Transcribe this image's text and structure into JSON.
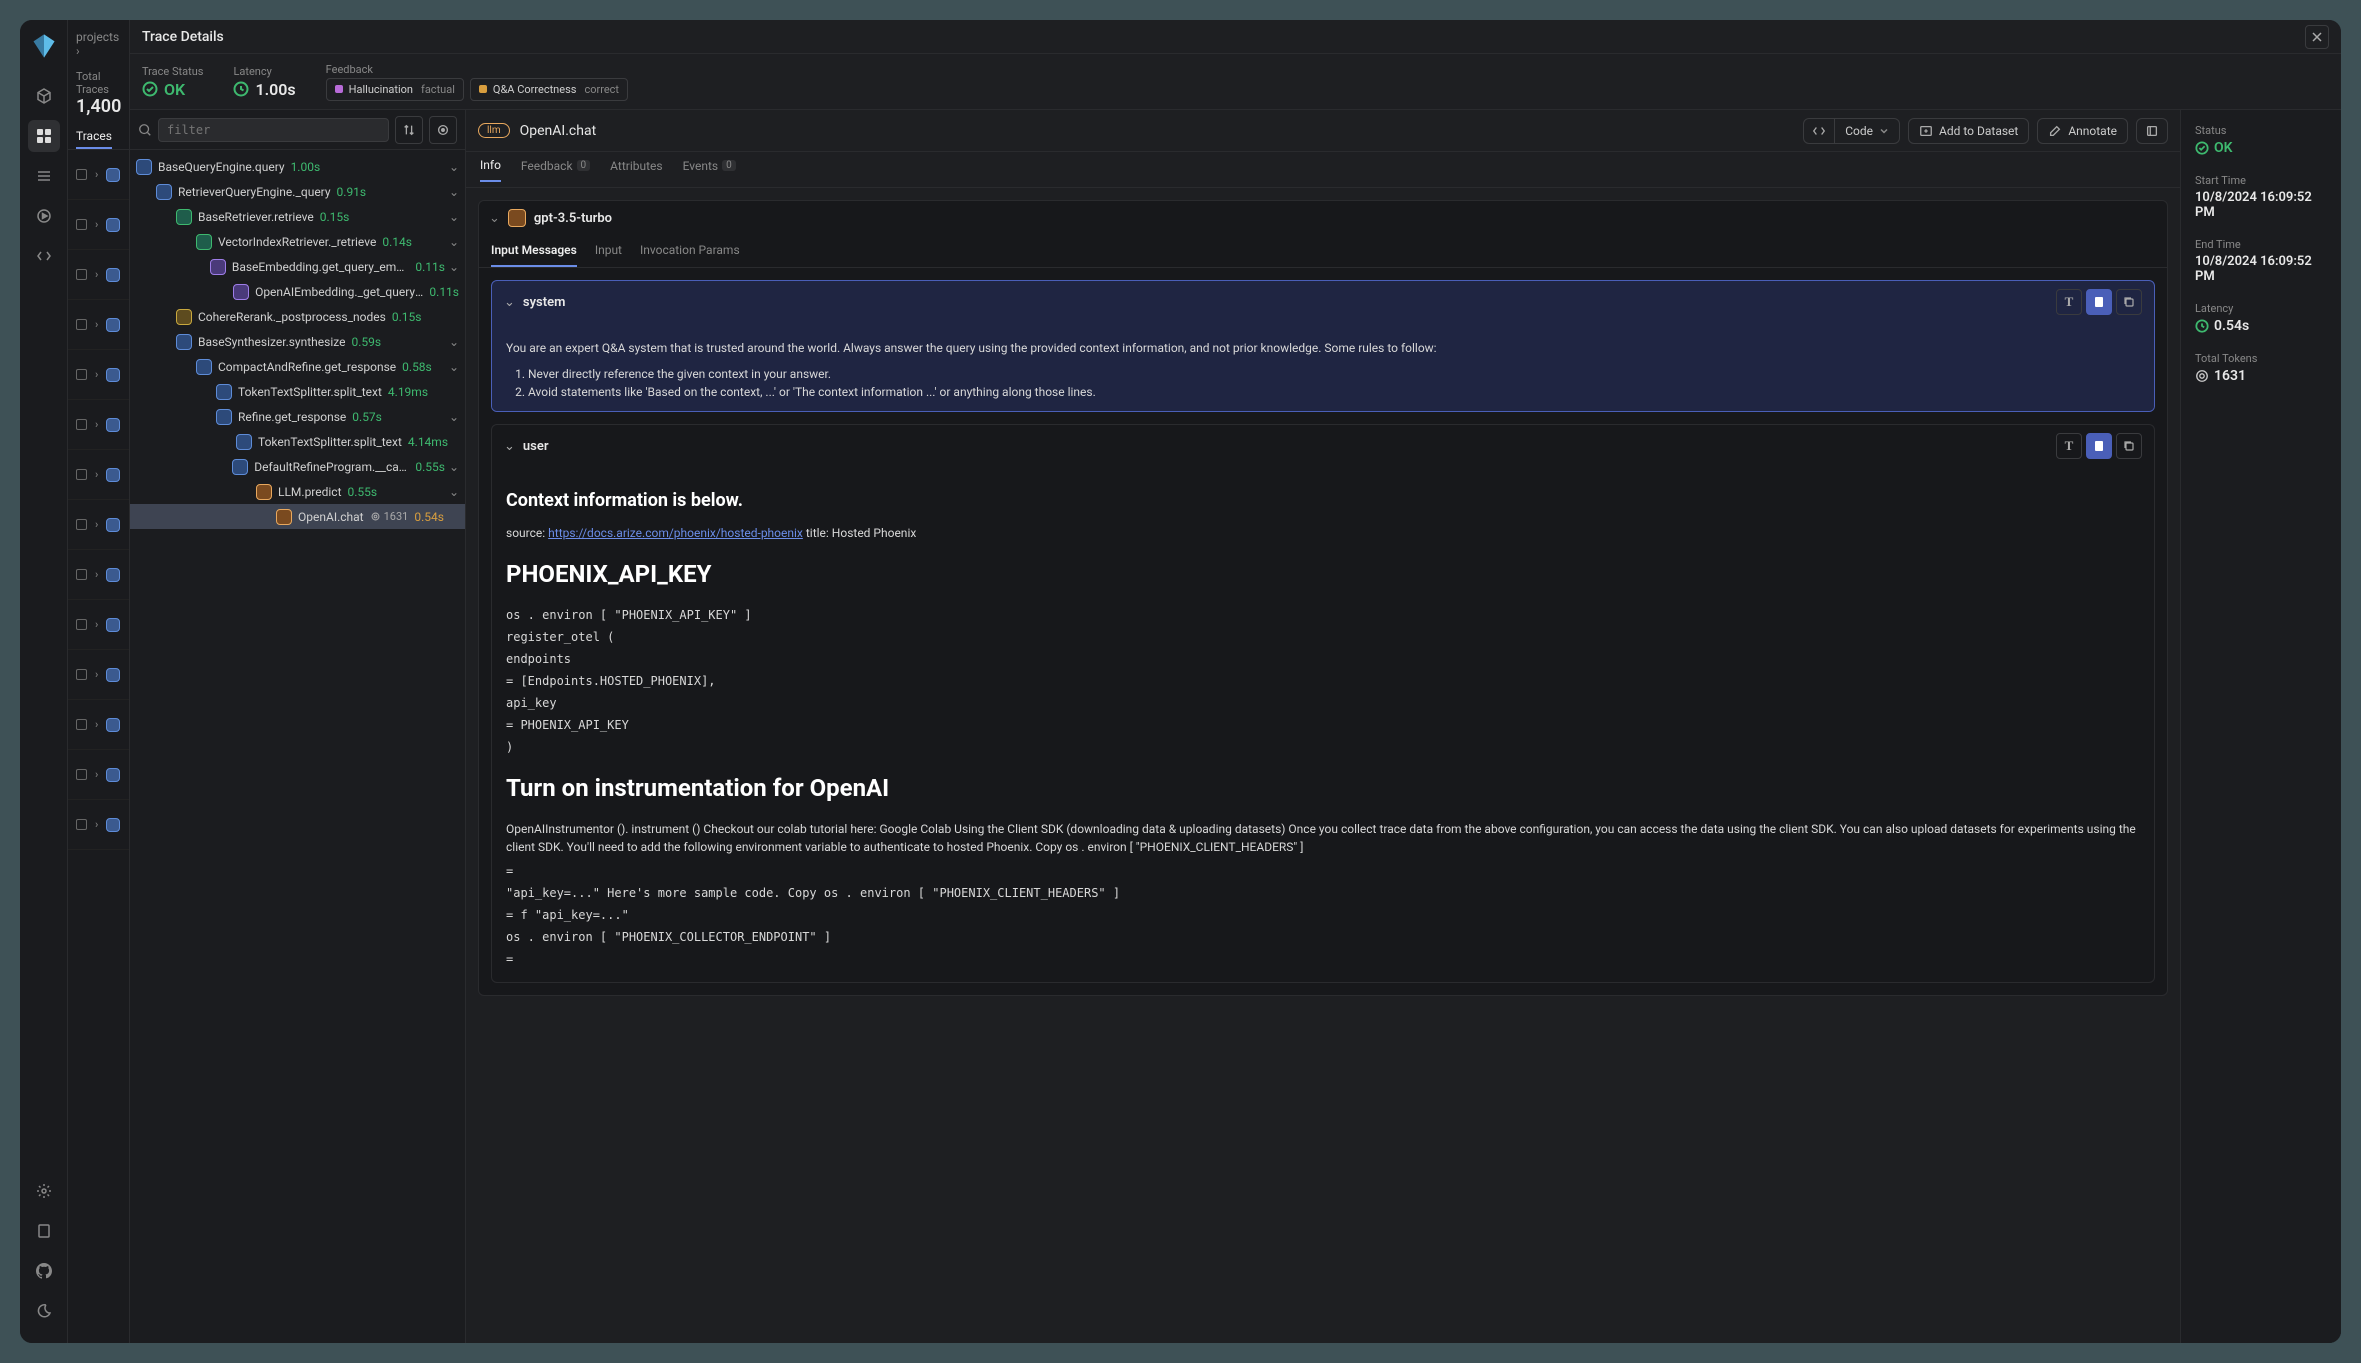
{
  "breadcrumb": "projects",
  "title": "Trace Details",
  "totals": {
    "label": "Total Traces",
    "value": "1,400",
    "tab": "Traces"
  },
  "status_bar": {
    "status_label": "Trace Status",
    "status_value": "OK",
    "latency_label": "Latency",
    "latency_value": "1.00s",
    "feedback_label": "Feedback",
    "feedback_chips": [
      {
        "name": "Hallucination",
        "value": "factual",
        "color": "#b86bd8"
      },
      {
        "name": "Q&A Correctness",
        "value": "correct",
        "color": "#d89e3e"
      }
    ]
  },
  "search": {
    "placeholder": "filter"
  },
  "spans": [
    {
      "depth": 0,
      "kind": "chain",
      "name": "BaseQueryEngine.query",
      "dur": "1.00s",
      "dur_color": "green",
      "expand": true
    },
    {
      "depth": 1,
      "kind": "chain",
      "name": "RetrieverQueryEngine._query",
      "dur": "0.91s",
      "dur_color": "green",
      "expand": true
    },
    {
      "depth": 2,
      "kind": "retriever",
      "name": "BaseRetriever.retrieve",
      "dur": "0.15s",
      "dur_color": "green",
      "expand": true
    },
    {
      "depth": 3,
      "kind": "retriever",
      "name": "VectorIndexRetriever._retrieve",
      "dur": "0.14s",
      "dur_color": "green",
      "expand": true
    },
    {
      "depth": 4,
      "kind": "embed",
      "name": "BaseEmbedding.get_query_embed…",
      "dur": "0.11s",
      "dur_color": "green",
      "expand": true
    },
    {
      "depth": 5,
      "kind": "embed",
      "name": "OpenAIEmbedding._get_query_…",
      "dur": "0.11s",
      "dur_color": "green"
    },
    {
      "depth": 2,
      "kind": "rerank",
      "name": "CohereRerank._postprocess_nodes",
      "dur": "0.15s",
      "dur_color": "green"
    },
    {
      "depth": 2,
      "kind": "chain",
      "name": "BaseSynthesizer.synthesize",
      "dur": "0.59s",
      "dur_color": "green",
      "expand": true
    },
    {
      "depth": 3,
      "kind": "chain",
      "name": "CompactAndRefine.get_response",
      "dur": "0.58s",
      "dur_color": "green",
      "expand": true
    },
    {
      "depth": 4,
      "kind": "chain",
      "name": "TokenTextSplitter.split_text",
      "dur": "4.19ms",
      "dur_color": "green"
    },
    {
      "depth": 4,
      "kind": "chain",
      "name": "Refine.get_response",
      "dur": "0.57s",
      "dur_color": "green",
      "expand": true
    },
    {
      "depth": 5,
      "kind": "chain",
      "name": "TokenTextSplitter.split_text",
      "dur": "4.14ms",
      "dur_color": "green"
    },
    {
      "depth": 5,
      "kind": "chain",
      "name": "DefaultRefineProgram.__call__",
      "dur": "0.55s",
      "dur_color": "green",
      "expand": true
    },
    {
      "depth": 6,
      "kind": "llm",
      "name": "LLM.predict",
      "dur": "0.55s",
      "dur_color": "green",
      "expand": true
    },
    {
      "depth": 7,
      "kind": "llm",
      "name": "OpenAI.chat",
      "dur": "0.54s",
      "dur_color": "amber",
      "tokens": "1631",
      "selected": true
    }
  ],
  "span_header": {
    "pill": "llm",
    "title": "OpenAI.chat",
    "code_btn": "Code",
    "dataset_btn": "Add to Dataset",
    "annotate_btn": "Annotate"
  },
  "detail_tabs": [
    {
      "label": "Info",
      "active": true
    },
    {
      "label": "Feedback",
      "count": "0"
    },
    {
      "label": "Attributes"
    },
    {
      "label": "Events",
      "count": "0"
    }
  ],
  "model": {
    "name": "gpt-3.5-turbo",
    "sub_tabs": [
      {
        "label": "Input Messages",
        "active": true
      },
      {
        "label": "Input"
      },
      {
        "label": "Invocation Params"
      }
    ]
  },
  "messages": {
    "system": {
      "role": "system",
      "intro": "You are an expert Q&A system that is trusted around the world. Always answer the query using the provided context information, and not prior knowledge. Some rules to follow:",
      "rules": [
        "Never directly reference the given context in your answer.",
        "Avoid statements like 'Based on the context, ...' or 'The context information ...' or anything along those lines."
      ]
    },
    "user": {
      "role": "user",
      "h2": "Context information is below.",
      "source_label": "source:",
      "source_link": "https://docs.arize.com/phoenix/hosted-phoenix",
      "title_label": "title: Hosted Phoenix",
      "h1": "PHOENIX_API_KEY",
      "mono_lines_1": [
        "os . environ [ \"PHOENIX_API_KEY\" ]",
        "register_otel (",
        "endpoints",
        "= [Endpoints.HOSTED_PHOENIX],",
        "api_key",
        "= PHOENIX_API_KEY",
        ")"
      ],
      "h1_2": "Turn on instrumentation for OpenAI",
      "para": "OpenAIInstrumentor (). instrument () Checkout our colab tutorial here: Google Colab Using the Client SDK (downloading data & uploading datasets) Once you collect trace data from the above configuration, you can access the data using the client SDK. You can also upload datasets for experiments using the client SDK. You'll need to add the following environment variable to authenticate to hosted Phoenix. Copy os . environ [ \"PHOENIX_CLIENT_HEADERS\" ]",
      "mono_lines_2": [
        "=",
        "\"api_key=...\" Here's more sample code. Copy os . environ [ \"PHOENIX_CLIENT_HEADERS\" ]",
        "= f \"api_key=...\"",
        "os . environ [ \"PHOENIX_COLLECTOR_ENDPOINT\" ]",
        "="
      ]
    }
  },
  "meta": {
    "status_label": "Status",
    "status_value": "OK",
    "start_label": "Start Time",
    "start_value": "10/8/2024 16:09:52 PM",
    "end_label": "End Time",
    "end_value": "10/8/2024 16:09:52 PM",
    "latency_label": "Latency",
    "latency_value": "0.54s",
    "tokens_label": "Total Tokens",
    "tokens_value": "1631"
  }
}
